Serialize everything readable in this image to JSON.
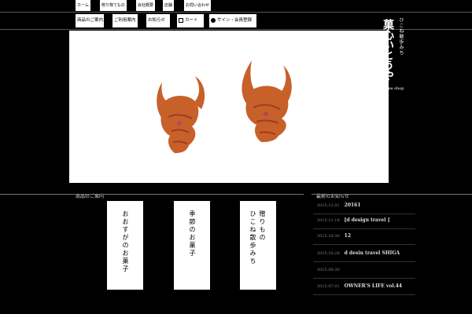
{
  "topnav": {
    "items": [
      "ホーム",
      "贈り物てもの",
      "会社概要",
      "店舗",
      "お問い合わせ"
    ]
  },
  "subnav": {
    "items": [
      "商品のご案内",
      "ご利用案内",
      "お知らせ",
      "カート",
      "サイン・会員登録"
    ]
  },
  "logo": {
    "sub": "ひこね散歩みち",
    "main": "菓心いとうや",
    "online": "Online shop"
  },
  "sections": {
    "products_title": "商品のご案内",
    "news_title": "最新のお知らせ"
  },
  "cards": [
    {
      "label": "おおすがのお菓子"
    },
    {
      "label": "季節のお菓子"
    },
    {
      "label_line1": "ひこね散歩みち",
      "label_line2": "贈りもの"
    }
  ],
  "news": [
    {
      "date": "2015.12.01",
      "title": "20161"
    },
    {
      "date": "2015.11.18",
      "title": "[d design travel ]"
    },
    {
      "date": "2015.10.30",
      "title": "12"
    },
    {
      "date": "2015.10.28",
      "title": "d desin travel SHIGA"
    },
    {
      "date": "2015.09.30",
      "title": ""
    },
    {
      "date": "2015.07.01",
      "title": "OWNER'S LIFE vol.44"
    }
  ],
  "colors": {
    "background": "#000000",
    "panel": "#ffffff",
    "product": "#c8602a"
  }
}
